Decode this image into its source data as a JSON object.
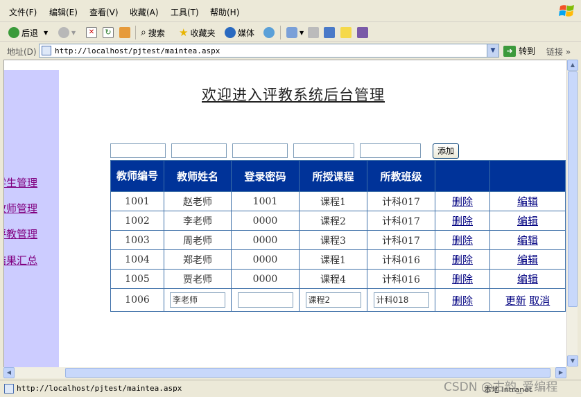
{
  "menu": [
    "文件(F)",
    "编辑(E)",
    "查看(V)",
    "收藏(A)",
    "工具(T)",
    "帮助(H)"
  ],
  "toolbar": {
    "back": "后退",
    "search": "搜索",
    "favorites": "收藏夹",
    "media": "媒体"
  },
  "address": {
    "label": "地址(D)",
    "url": "http://localhost/pjtest/maintea.aspx",
    "go": "转到",
    "links": "链接"
  },
  "sidebar": {
    "items": [
      "学生管理",
      "教师管理",
      "评教管理",
      "结果汇总"
    ]
  },
  "page": {
    "title": "欢迎进入评教系统后台管理",
    "add_button": "添加"
  },
  "table": {
    "headers": [
      "教师编号",
      "教师姓名",
      "登录密码",
      "所授课程",
      "所教班级",
      "",
      ""
    ],
    "rows": [
      [
        "1001",
        "赵老师",
        "1001",
        "课程1",
        "计科017",
        "删除",
        "编辑"
      ],
      [
        "1002",
        "李老师",
        "0000",
        "课程2",
        "计科017",
        "删除",
        "编辑"
      ],
      [
        "1003",
        "周老师",
        "0000",
        "课程3",
        "计科017",
        "删除",
        "编辑"
      ],
      [
        "1004",
        "郑老师",
        "0000",
        "课程1",
        "计科016",
        "删除",
        "编辑"
      ],
      [
        "1005",
        "贾老师",
        "0000",
        "课程4",
        "计科016",
        "删除",
        "编辑"
      ]
    ],
    "edit_row": {
      "id": "1006",
      "name_value": "李老师",
      "password_value": "",
      "course_value": "课程2",
      "class_value": "计科018",
      "delete": "删除",
      "update": "更新",
      "cancel": "取消"
    }
  },
  "status": {
    "url": "http://localhost/pjtest/maintea.aspx",
    "zone": "本地 Intranet"
  },
  "watermark": "CSDN @古韵_爱编程"
}
